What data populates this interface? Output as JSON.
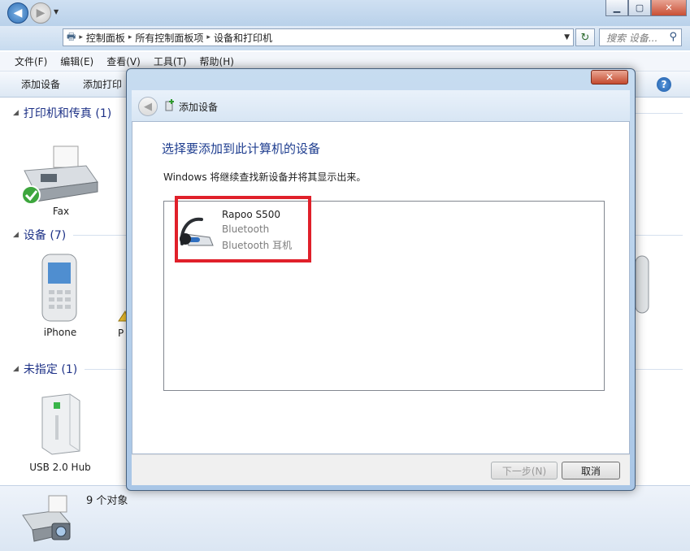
{
  "window": {
    "title": "设备和打印机",
    "breadcrumb": [
      "控制面板",
      "所有控制面板项",
      "设备和打印机"
    ],
    "search_placeholder": "搜索 设备..."
  },
  "menu": [
    "文件(F)",
    "编辑(E)",
    "查看(V)",
    "工具(T)",
    "帮助(H)"
  ],
  "toolbar": {
    "add_device": "添加设备",
    "add_printer": "添加打印"
  },
  "groups": {
    "printers": {
      "label": "打印机和传真 (1)",
      "items": [
        "Fax"
      ]
    },
    "devices": {
      "label": "设备 (7)",
      "items": [
        "iPhone",
        "P"
      ]
    },
    "unspecified": {
      "label": "未指定 (1)",
      "items": [
        "USB 2.0 Hub"
      ]
    }
  },
  "status": {
    "count": "9 个对象"
  },
  "dialog": {
    "title": "添加设备",
    "heading": "选择要添加到此计算机的设备",
    "description": "Windows 将继续查找新设备并将其显示出来。",
    "device": {
      "name": "Rapoo S500",
      "type": "Bluetooth",
      "category": "Bluetooth 耳机"
    },
    "next_button": "下一步(N)",
    "cancel_button": "取消"
  },
  "icons": {
    "close": "close-icon",
    "back": "back-arrow-icon",
    "add_device": "add-device-icon",
    "headset": "bluetooth-headset-icon"
  },
  "colors": {
    "highlight_box": "#e0202a",
    "heading_blue": "#1e3d8f",
    "dialog_frame": "#a9c6e6"
  }
}
